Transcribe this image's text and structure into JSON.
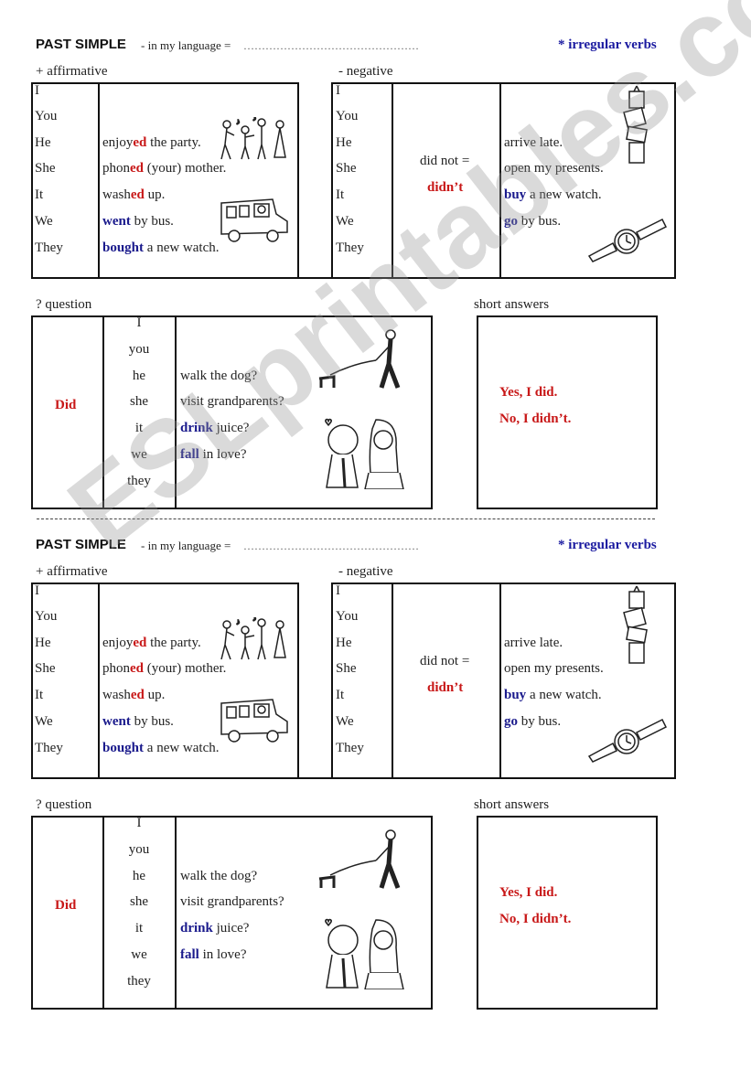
{
  "watermark": "ESLprintables.com",
  "header": {
    "title": "PAST SIMPLE",
    "subtitle": "- in my language =",
    "dots": "…………………………………………",
    "irregular_note": "* irregular verbs"
  },
  "affirmative": {
    "label": "+  affirmative",
    "pronouns": [
      "I",
      "You",
      "He",
      "She",
      "It",
      "We",
      "They"
    ],
    "phrases": [
      {
        "stem": "enjoy",
        "ending": "ed",
        "rest": " the party."
      },
      {
        "stem": "phon",
        "ending": "ed",
        "rest": " (your) mother."
      },
      {
        "stem": "wash",
        "ending": "ed",
        "rest": " up."
      },
      {
        "irregular": "went",
        "rest": " by bus."
      },
      {
        "irregular": "bought",
        "rest": " a new watch."
      }
    ]
  },
  "negative": {
    "label": "-  negative",
    "pronouns": [
      "I",
      "You",
      "He",
      "She",
      "It",
      "We",
      "They"
    ],
    "did_not": "did not =",
    "didnt": "didn’t",
    "phrases": [
      {
        "plain": "arrive late."
      },
      {
        "plain": "open my presents."
      },
      {
        "irregular": "buy",
        "rest": " a new watch."
      },
      {
        "irregular": "go",
        "rest": " by bus."
      }
    ]
  },
  "question": {
    "label": "?  question",
    "did": "Did",
    "pronouns": [
      "I",
      "you",
      "he",
      "she",
      "it",
      "we",
      "they"
    ],
    "phrases": [
      {
        "plain": "walk the dog?"
      },
      {
        "plain": "visit grandparents?"
      },
      {
        "irregular": "drink",
        "rest": " juice?"
      },
      {
        "irregular": "fall",
        "rest": " in love?"
      }
    ]
  },
  "short_answers": {
    "label": "short answers",
    "yes": "Yes, I did.",
    "no": "No, I didn’t."
  },
  "colors": {
    "regular_ending": "#c81818",
    "irregular": "#1a1a8c",
    "border": "#111111"
  },
  "icons": [
    "party-people-icon",
    "bus-icon",
    "presents-stack-icon",
    "watch-icon",
    "dog-walker-icon",
    "couple-icon"
  ]
}
